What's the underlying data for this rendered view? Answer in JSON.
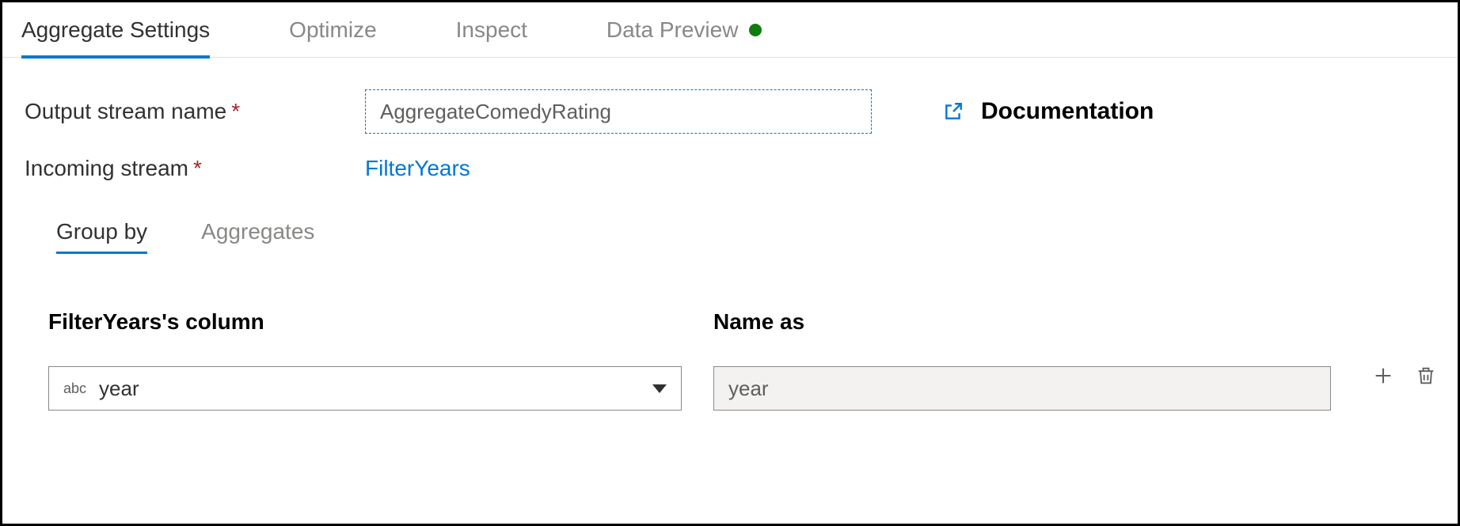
{
  "tabs": {
    "settings": "Aggregate Settings",
    "optimize": "Optimize",
    "inspect": "Inspect",
    "preview": "Data Preview"
  },
  "fields": {
    "output_stream_label": "Output stream name",
    "output_stream_value": "AggregateComedyRating",
    "incoming_stream_label": "Incoming stream",
    "incoming_stream_value": "FilterYears",
    "documentation_label": "Documentation"
  },
  "subtabs": {
    "groupby": "Group by",
    "aggregates": "Aggregates"
  },
  "groupby": {
    "column_header": "FilterYears's column",
    "name_header": "Name as",
    "type_tag": "abc",
    "column_value": "year",
    "name_value": "year"
  }
}
